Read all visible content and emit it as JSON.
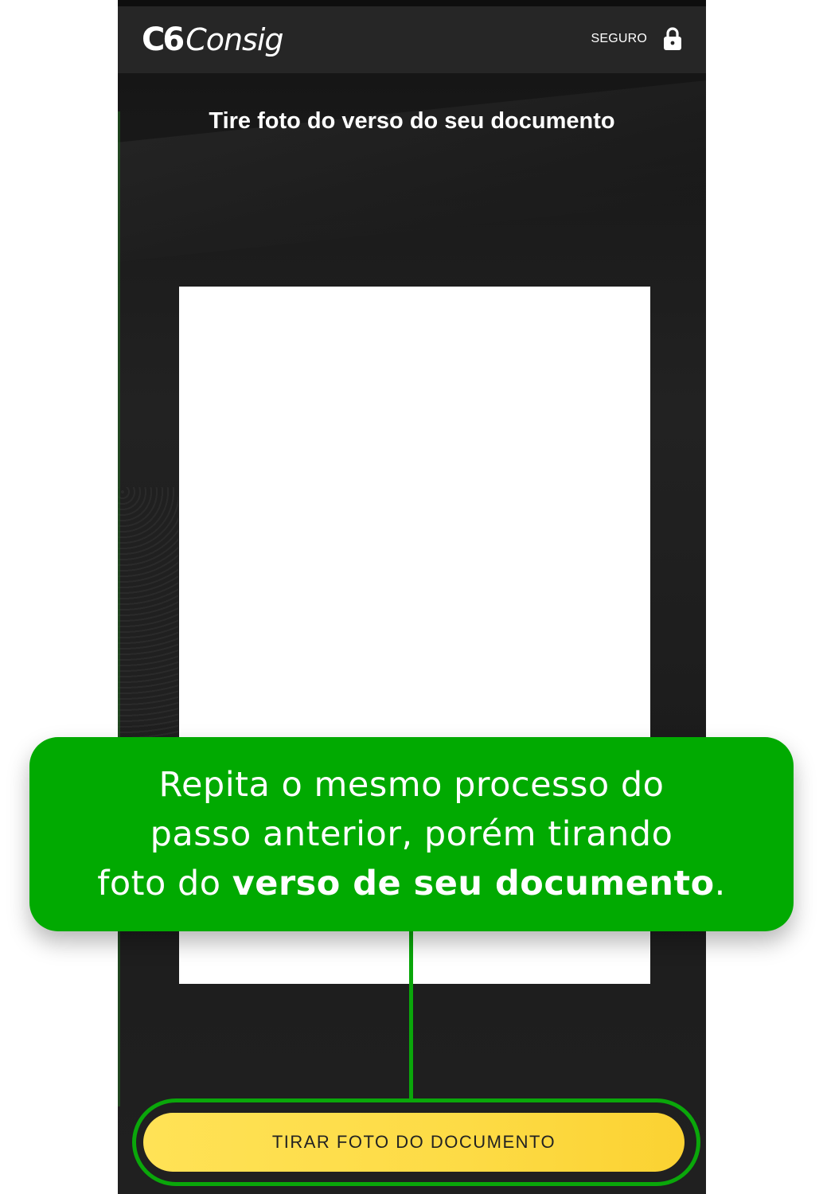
{
  "header": {
    "logo_mark": "C6",
    "logo_name": "Consig",
    "secure_label": "SEGURO",
    "secure_icon": "lock-icon"
  },
  "camera": {
    "title": "Tire foto do verso do seu documento",
    "capture_button_label": "TIRAR FOTO DO DOCUMENTO"
  },
  "callout": {
    "line1": "Repita o mesmo processo do",
    "line2": "passo anterior, porém tirando",
    "line3_prefix": "foto do ",
    "line3_bold": "verso de seu documento",
    "line3_suffix": "."
  },
  "colors": {
    "accent_green": "#01aa01",
    "button_yellow": "#fddb45",
    "header_bg": "#262626"
  }
}
